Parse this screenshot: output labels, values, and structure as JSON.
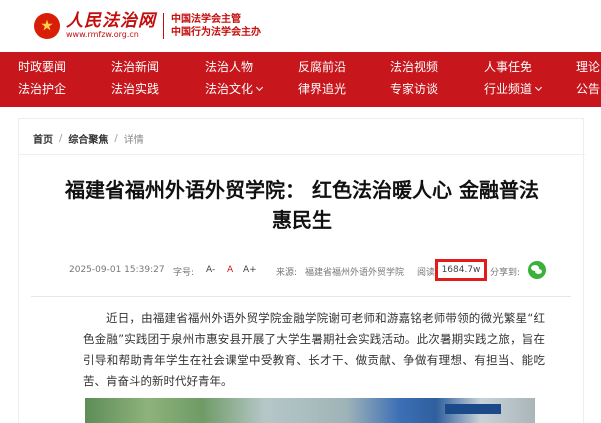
{
  "header": {
    "brand_name": "人民法治网",
    "brand_url": "www.rmfzw.org.cn",
    "sponsor_line1": "中国法学会主管",
    "sponsor_line2": "中国行为法学会主办"
  },
  "nav": {
    "row1": [
      "时政要闻",
      "法治新闻",
      "法治人物",
      "反腐前沿",
      "法治视频",
      "人事任免",
      "理论"
    ],
    "row2": [
      "法治护企",
      "法治实践",
      "法治文化",
      "律界追光",
      "专家访谈",
      "行业频道",
      "公告"
    ]
  },
  "breadcrumb": {
    "home": "首页",
    "section": "综合聚焦",
    "current": "详情"
  },
  "article": {
    "title": "福建省福州外语外贸学院：  红色法治暖人心 金融普法惠民生",
    "date": "2025-09-01 15:39:27",
    "font_label": "字号:",
    "font_small": "A-",
    "font_medium": "A",
    "font_large": "A+",
    "source_label": "来源:",
    "source": "福建省福州外语外贸学院",
    "views_label": "阅读",
    "views": "1684.7w",
    "share_label": "分享到:",
    "paragraph": "近日，由福建省福州外语外贸学院金融学院谢可老师和游嘉铭老师带领的微光繁星“红色金融”实践团于泉州市惠安县开展了大学生暑期社会实践活动。此次暑期实践之旅，旨在引导和帮助青年学生在社会课堂中受教育、长才干、做贡献、争做有理想、有担当、能吃苦、肯奋斗的新时代好青年。"
  },
  "colors": {
    "brand_red": "#c8161d",
    "highlight_box": "#e21b1b",
    "wechat_green": "#3bb03b"
  }
}
